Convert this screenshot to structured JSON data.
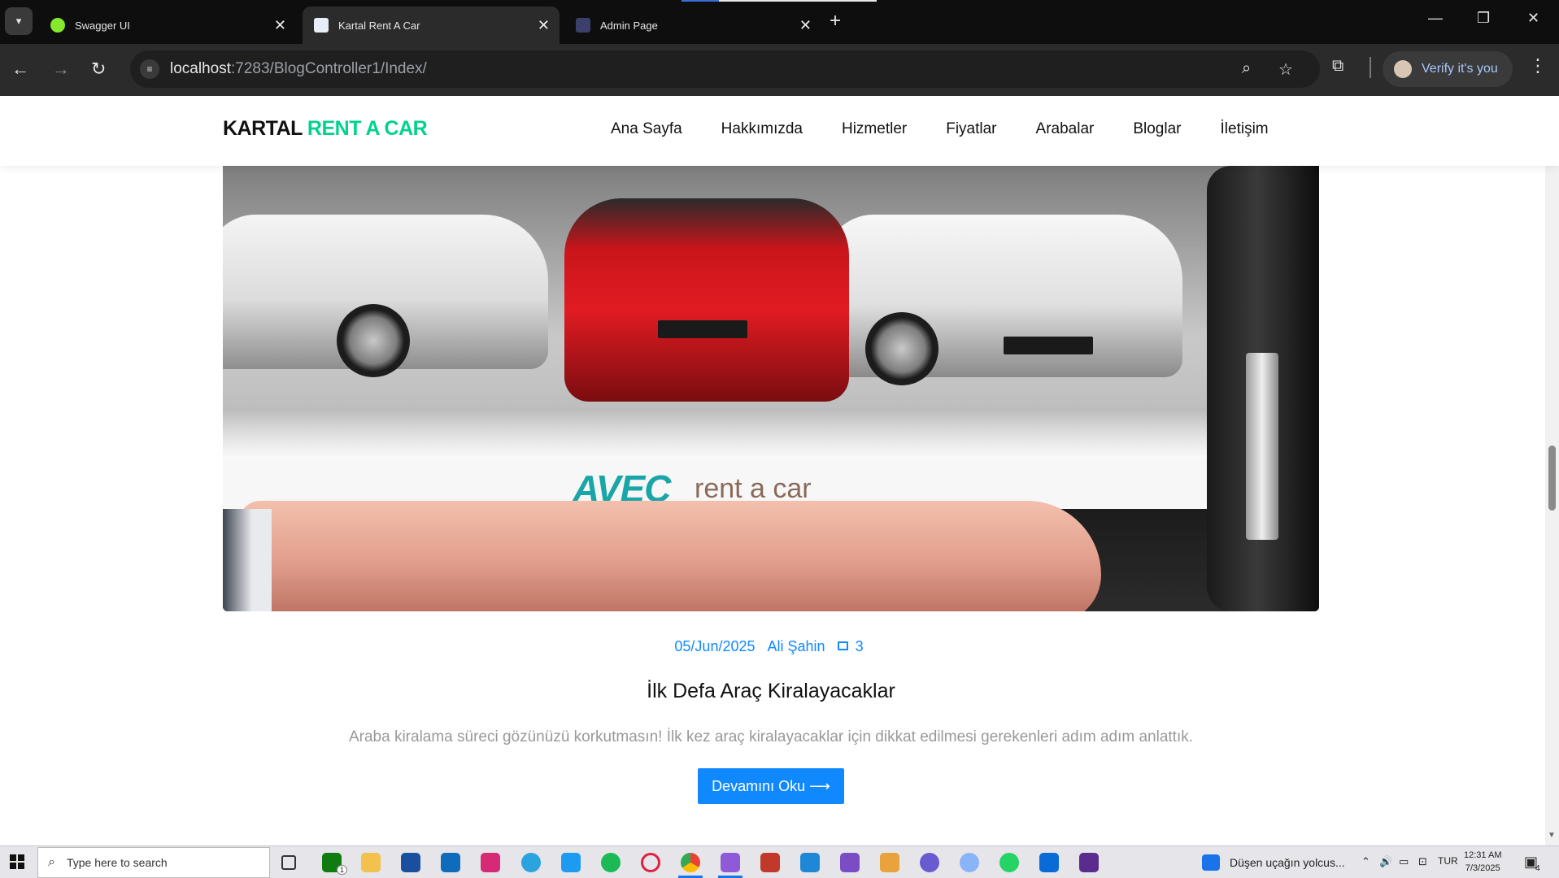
{
  "browser": {
    "tabs": [
      {
        "title": "Swagger UI",
        "active": false,
        "favicon_color": "#85ea2d"
      },
      {
        "title": "Kartal Rent A Car",
        "active": true,
        "favicon_color": "#e8eef8"
      },
      {
        "title": "Admin Page",
        "active": false,
        "favicon_color": "#3a3f6b"
      }
    ],
    "url_host": "localhost",
    "url_rest": ":7283/BlogController1/Index/",
    "verify_label": "Verify it's you"
  },
  "site": {
    "logo_part1": "KARTAL",
    "logo_part2": "RENT A CAR",
    "accent": "#01d28e",
    "primary": "#1089ff",
    "nav": [
      "Ana Sayfa",
      "Hakkımızda",
      "Hizmetler",
      "Fiyatlar",
      "Arabalar",
      "Bloglar",
      "İletişim"
    ]
  },
  "hero": {
    "brand_logo": "AVEC",
    "brand_tagline": "rent a car"
  },
  "post": {
    "date": "05/Jun/2025",
    "author": "Ali Şahin",
    "comment_count": "3",
    "title": "İlk Defa Araç Kiralayacaklar",
    "excerpt": "Araba kiralama süreci gözünüzü korkutmasın! İlk kez araç kiralayacaklar için dikkat edilmesi gerekenleri adım adım anlattık.",
    "read_more": "Devamını Oku ⟶"
  },
  "taskbar": {
    "search_placeholder": "Type here to search",
    "weather_text": "Düşen uçağın yolcus...",
    "language": "TUR",
    "time": "12:31 AM",
    "date": "7/3/2025",
    "xbox_badge": "1",
    "notif_count": "4"
  }
}
